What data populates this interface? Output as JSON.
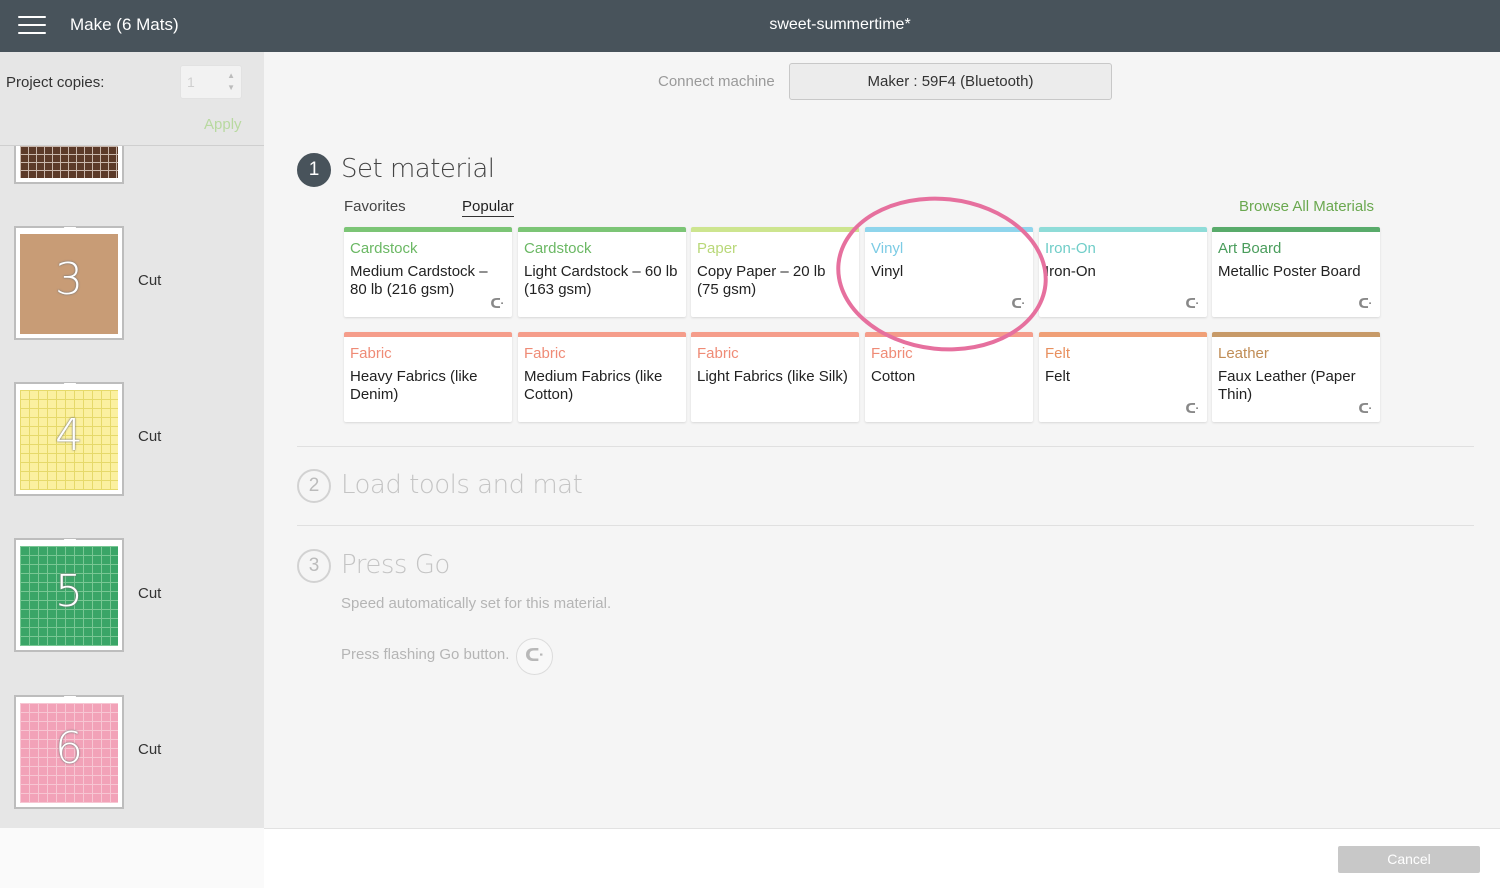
{
  "header": {
    "app_title": "Make (6 Mats)",
    "document_title": "sweet-summertime*"
  },
  "sidebar": {
    "copies_label": "Project copies:",
    "copies_value": "1",
    "apply_label": "Apply",
    "mats": [
      {
        "number": "3",
        "status": "Cut",
        "color": "#c89c76"
      },
      {
        "number": "4",
        "status": "Cut",
        "color": "#fbf0a0"
      },
      {
        "number": "5",
        "status": "Cut",
        "color": "#3aa567"
      },
      {
        "number": "6",
        "status": "Cut",
        "color": "#f2a2b8"
      }
    ]
  },
  "connect": {
    "label": "Connect machine",
    "machine": "Maker : 59F4 (Bluetooth)"
  },
  "steps": [
    {
      "number": "1",
      "title": "Set material"
    },
    {
      "number": "2",
      "title": "Load tools and mat"
    },
    {
      "number": "3",
      "title": "Press Go"
    }
  ],
  "tabs": {
    "favorites": "Favorites",
    "popular": "Popular"
  },
  "browse_all": "Browse All Materials",
  "materials": [
    {
      "category": "Cardstock",
      "name": "Medium Cardstock – 80 lb (216 gsm)",
      "color": "#7cc576",
      "cat_color": "#6bb864",
      "icon": "cricut-icon"
    },
    {
      "category": "Cardstock",
      "name": "Light Cardstock – 60 lb (163 gsm)",
      "color": "#7cc576",
      "cat_color": "#6bb864"
    },
    {
      "category": "Paper",
      "name": "Copy Paper – 20 lb (75 gsm)",
      "color": "#cde58f",
      "cat_color": "#b9d879"
    },
    {
      "category": "Vinyl",
      "name": "Vinyl",
      "color": "#8fd5ec",
      "cat_color": "#7ccbe4",
      "icon": "cricut-icon"
    },
    {
      "category": "Iron-On",
      "name": "Iron-On",
      "color": "#8fdcd8",
      "cat_color": "#6fcdc8",
      "icon": "cricut-icon"
    },
    {
      "category": "Art Board",
      "name": "Metallic Poster Board",
      "color": "#59ab6b",
      "cat_color": "#4a9d5c",
      "icon": "cricut-icon"
    },
    {
      "category": "Fabric",
      "name": "Heavy Fabrics (like Denim)",
      "color": "#f59d8b",
      "cat_color": "#ef8b76"
    },
    {
      "category": "Fabric",
      "name": "Medium Fabrics (like Cotton)",
      "color": "#f59d8b",
      "cat_color": "#ef8b76"
    },
    {
      "category": "Fabric",
      "name": "Light Fabrics (like Silk)",
      "color": "#f59d8b",
      "cat_color": "#ef8b76"
    },
    {
      "category": "Fabric",
      "name": "Cotton",
      "color": "#f59d8b",
      "cat_color": "#ef8b76"
    },
    {
      "category": "Felt",
      "name": "Felt",
      "color": "#f0a077",
      "cat_color": "#e8905f",
      "icon": "cricut-icon"
    },
    {
      "category": "Leather",
      "name": "Faux Leather (Paper Thin)",
      "color": "#c79a68",
      "cat_color": "#c08d56",
      "icon": "cricut-icon"
    }
  ],
  "press_go": {
    "speed_text": "Speed automatically set for this material.",
    "go_text": "Press flashing Go button."
  },
  "footer": {
    "cancel_label": "Cancel"
  }
}
